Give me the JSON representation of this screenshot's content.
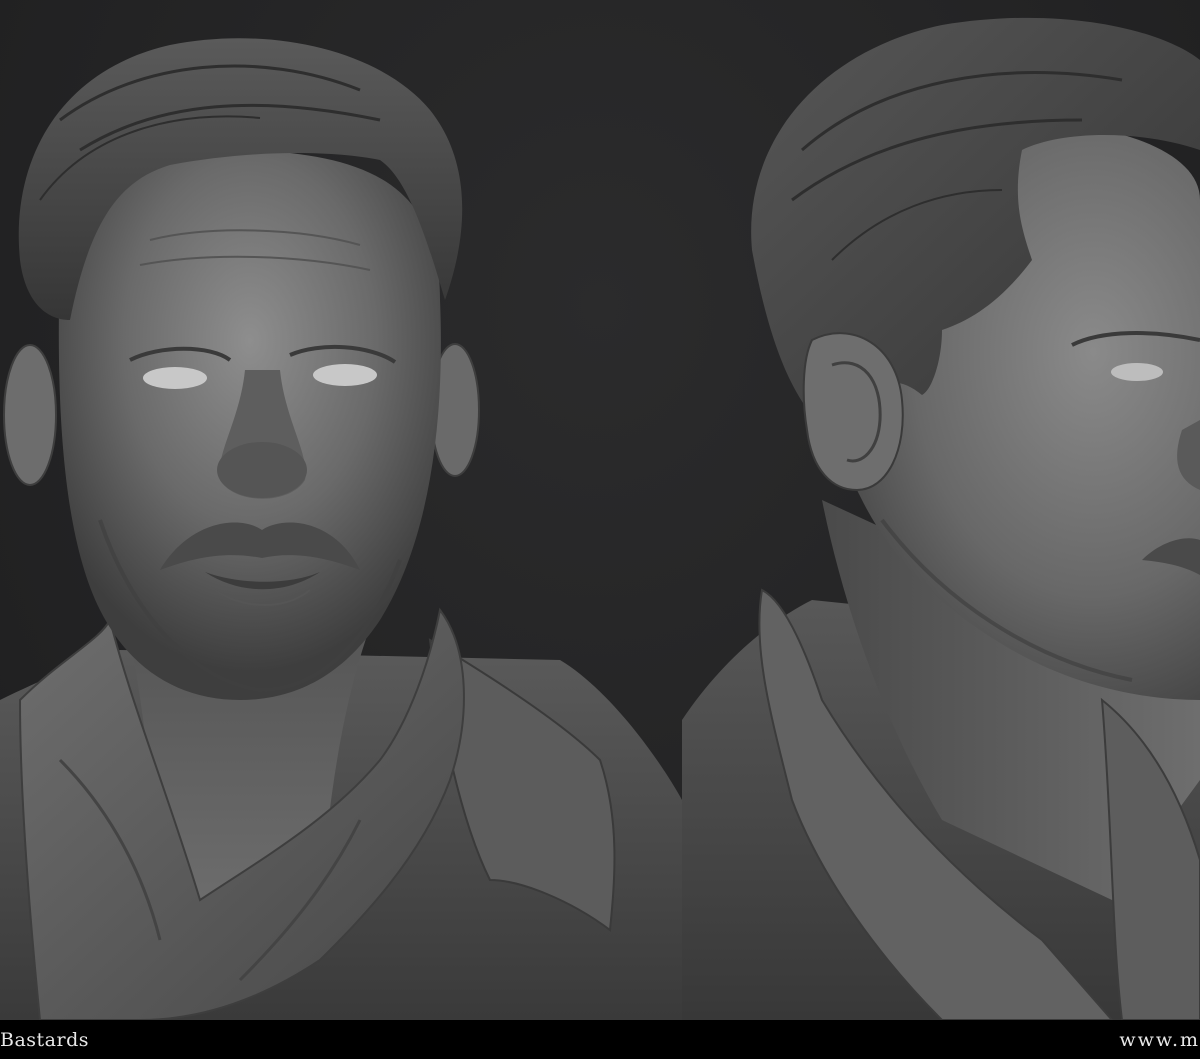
{
  "image": {
    "description_panels": [
      "front-view",
      "three-quarter-view"
    ],
    "colors": {
      "background": "#232324",
      "sculpt_clay": "#7a7a7a",
      "caption_bar": "#000000",
      "caption_text": "#e8e8e8"
    }
  },
  "caption": {
    "left_text": "Bastards",
    "right_text": "www.m"
  }
}
